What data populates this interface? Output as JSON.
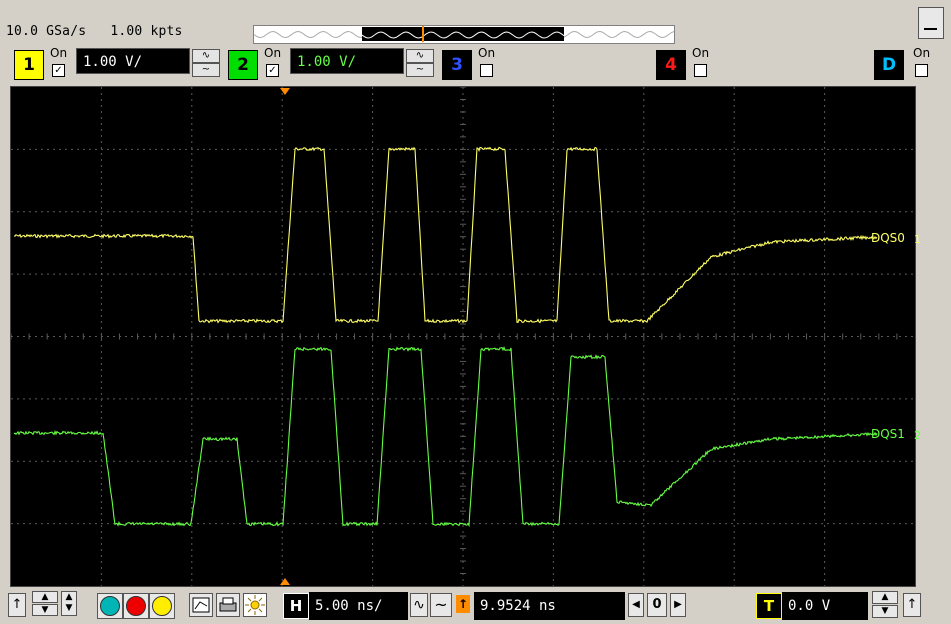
{
  "header": {
    "acquisition": "10.0 GSa/s   1.00 kpts"
  },
  "channels": [
    {
      "number": "1",
      "on_label": "On",
      "checked": "✓",
      "scale": "1.00 V/",
      "color": "#ffff00",
      "text_color": "#000000"
    },
    {
      "number": "2",
      "on_label": "On",
      "checked": "✓",
      "scale": "1.00 V/",
      "color": "#00dd00",
      "text_color": "#000000"
    },
    {
      "number": "3",
      "on_label": "On",
      "checked": "",
      "color": "#3050ff",
      "text_color": "#000000"
    },
    {
      "number": "4",
      "on_label": "On",
      "checked": "",
      "color": "#ff1a1a",
      "text_color": "#000000"
    },
    {
      "number": "D",
      "on_label": "On",
      "checked": "",
      "color": "#00bfff",
      "text_color": "#ffffff"
    }
  ],
  "coupling": {
    "dc": "∿",
    "ac": "~"
  },
  "traces": [
    {
      "name": "DQS0",
      "marker": "1",
      "trigger_marker": "T",
      "color": "#ffff66"
    },
    {
      "name": "DQS1",
      "marker": "2",
      "color": "#66ff44"
    }
  ],
  "horizontal": {
    "label": "H",
    "scale": "5.00 ns/",
    "position": "9.9524 ns"
  },
  "trigger": {
    "label": "T",
    "level": "0.0 V"
  },
  "navigation": {
    "value": "0",
    "prev": "◀",
    "next": "▶"
  },
  "colors": {
    "grid": "#5a5a5a",
    "trigger_marker": "#ff8c00"
  }
}
